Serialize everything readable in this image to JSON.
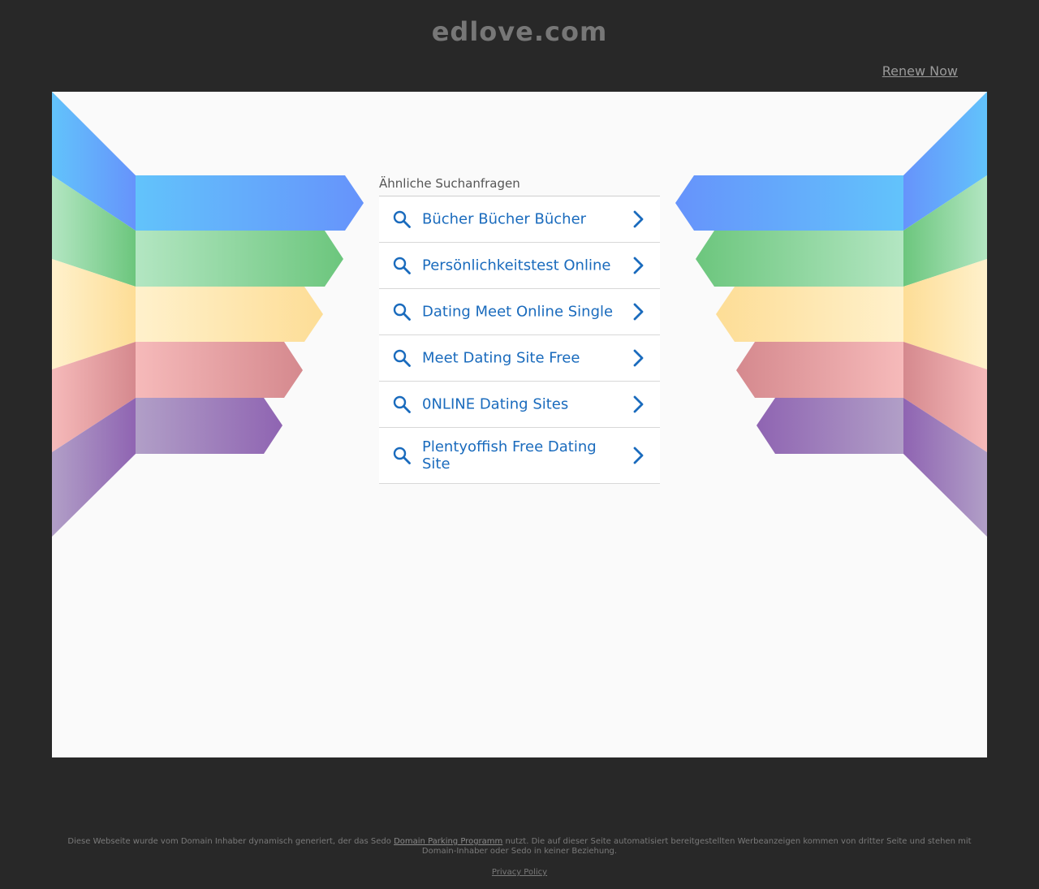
{
  "header": {
    "domain": "edlove.com",
    "renew_label": "Renew Now"
  },
  "search": {
    "heading": "Ähnliche Suchanfragen",
    "items": [
      {
        "label": "Bücher Bücher Bücher"
      },
      {
        "label": "Persönlichkeitstest Online"
      },
      {
        "label": "Dating Meet Online Single"
      },
      {
        "label": "Meet Dating Site Free"
      },
      {
        "label": "0NLINE Dating Sites"
      },
      {
        "label": "Plentyoffish Free Dating Site"
      }
    ],
    "item_icon": "search-icon",
    "item_arrow": "chevron-right-icon"
  },
  "footer": {
    "text_before": "Diese Webseite wurde vom Domain Inhaber dynamisch generiert, der das Sedo ",
    "link_label": "Domain Parking Programm",
    "text_after": " nutzt. Die auf dieser Seite automatisiert bereitgestellten Werbeanzeigen kommen von dritter Seite und stehen mit Domain-Inhaber oder Sedo in keiner Beziehung.",
    "privacy_label": "Privacy Policy"
  },
  "colors": {
    "background": "#282828",
    "panel": "#fafafa",
    "link": "#1a6bbd",
    "wing_blue_light": "#62c3fb",
    "wing_blue_dark": "#6693fb",
    "wing_green_light": "#b3e6c2",
    "wing_green_dark": "#6cc67d",
    "wing_yellow_light": "#fff1cc",
    "wing_yellow_dark": "#fddd96",
    "wing_red_light": "#f6baba",
    "wing_red_dark": "#d5898e",
    "wing_purple_light": "#b19fc7",
    "wing_purple_dark": "#8f64b2"
  }
}
